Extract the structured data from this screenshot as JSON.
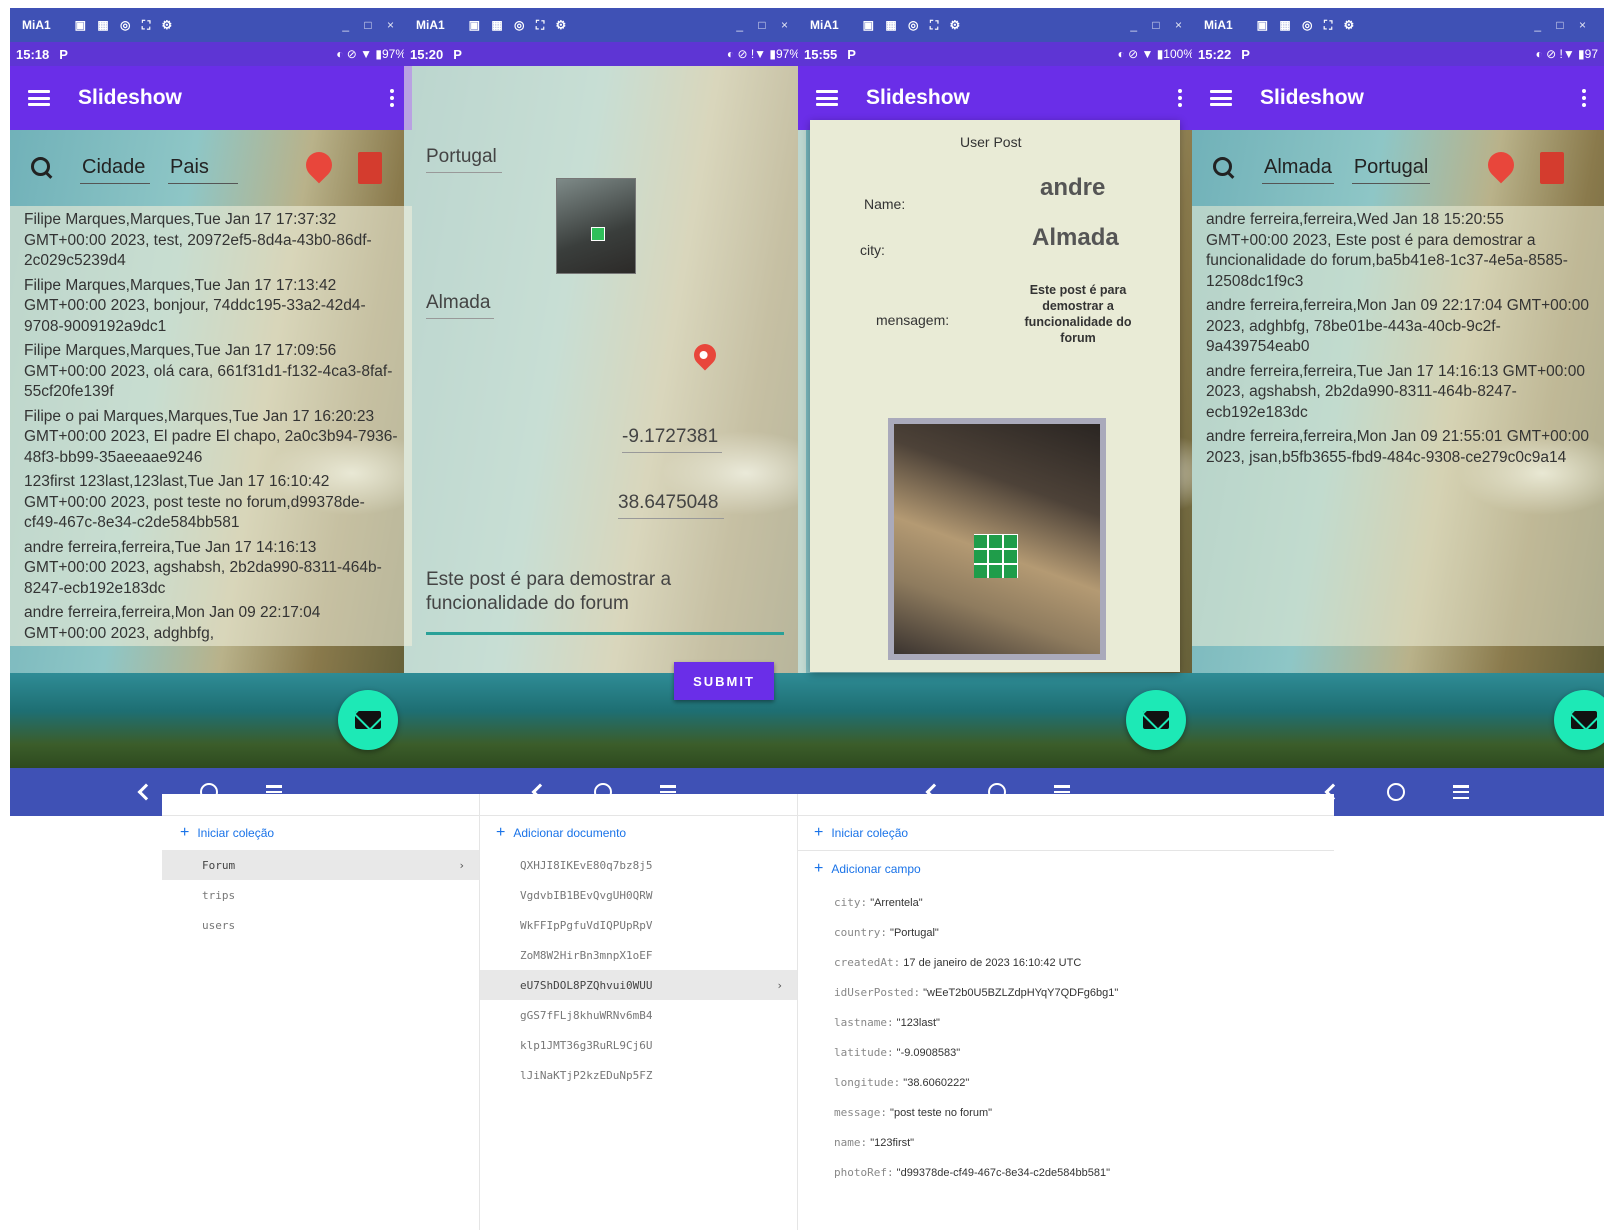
{
  "emulator": {
    "title": "MiA1",
    "toolbar_icons": "▣ ▦ ◎ ⛶ ⚙",
    "window_controls": "_ □ ×"
  },
  "phones": [
    {
      "time": "15:18",
      "status_right": "◐ ⊘ ▼ ▮97%",
      "appbar_title": "Slideshow",
      "search": {
        "city": "Cidade",
        "country": "Pais"
      },
      "posts": [
        "Filipe Marques,Marques,Tue Jan 17 17:37:32 GMT+00:00 2023, test, 20972ef5-8d4a-43b0-86df-2c029c5239d4",
        "Filipe Marques,Marques,Tue Jan 17 17:13:42 GMT+00:00 2023, bonjour, 74ddc195-33a2-42d4-9708-9009192a9dc1",
        "Filipe Marques,Marques,Tue Jan 17 17:09:56 GMT+00:00 2023, olá cara, 661f31d1-f132-4ca3-8faf-55cf20fe139f",
        "Filipe o pai Marques,Marques,Tue Jan 17 16:20:23 GMT+00:00 2023, El padre El chapo, 2a0c3b94-7936-48f3-bb99-35aeeaae9246",
        "123first 123last,123last,Tue Jan 17 16:10:42 GMT+00:00 2023, post teste no forum,d99378de-cf49-467c-8e34-c2de584bb581",
        "andre ferreira,ferreira,Tue Jan 17 14:16:13 GMT+00:00 2023, agshabsh, 2b2da990-8311-464b-8247-ecb192e183dc",
        "andre ferreira,ferreira,Mon Jan 09 22:17:04 GMT+00:00 2023, adghbfg,"
      ]
    },
    {
      "time": "15:20",
      "status_right": "◐ ⊘ !▼ ▮97%",
      "country": "Portugal",
      "city": "Almada",
      "longitude": "-9.1727381",
      "latitude": "38.6475048",
      "message": "Este post é para demostrar a funcionalidade do forum",
      "submit_label": "SUBMIT"
    },
    {
      "time": "15:55",
      "status_right": "◐ ⊘ ▼ ▮100%",
      "appbar_title": "Slideshow",
      "dialog": {
        "title": "User Post",
        "name_label": "Name:",
        "name_value": "andre",
        "city_label": "city:",
        "city_value": "Almada",
        "message_label": "mensagem:",
        "message_value": "Este post é para demostrar a funcionalidade do forum"
      }
    },
    {
      "time": "15:22",
      "status_right": "◐ ⊘ !▼ ▮97",
      "appbar_title": "Slideshow",
      "search": {
        "city": "Almada",
        "country": "Portugal"
      },
      "posts": [
        "andre ferreira,ferreira,Wed Jan 18 15:20:55 GMT+00:00 2023, Este post é para demostrar a funcionalidade do forum,ba5b41e8-1c37-4e5a-8585-12508dc1f9c3",
        "andre ferreira,ferreira,Mon Jan 09 22:17:04 GMT+00:00 2023, adghbfg, 78be01be-443a-40cb-9c2f-9a439754eab0",
        "andre ferreira,ferreira,Tue Jan 17 14:16:13 GMT+00:00 2023, agshabsh, 2b2da990-8311-464b-8247-ecb192e183dc",
        "andre ferreira,ferreira,Mon Jan 09 21:55:01 GMT+00:00 2023, jsan,b5fb3655-fbd9-484c-9308-ce279c0c9a14"
      ]
    }
  ],
  "firestore": {
    "start_collection": "Iniciar coleção",
    "collections": [
      "Forum",
      "trips",
      "users"
    ],
    "add_document": "Adicionar documento",
    "documents": [
      "QXHJI8IKEvE80q7bz8j5",
      "VgdvbIB1BEvQvgUH0QRW",
      "WkFFIpPgfuVdIQPUpRpV",
      "ZoM8W2HirBn3mnpX1oEF",
      "eU7ShDOL8PZQhvui0WUU",
      "gGS7fFLj8khuWRNv6mB4",
      "klp1JMT36g3RuRL9Cj6U",
      "lJiNaKTjP2kzEDuNp5FZ"
    ],
    "start_collection_2": "Iniciar coleção",
    "add_field": "Adicionar campo",
    "fields": [
      {
        "key": "city:",
        "value": "\"Arrentela\""
      },
      {
        "key": "country:",
        "value": "\"Portugal\""
      },
      {
        "key": "createdAt:",
        "value": "17 de janeiro de 2023 16:10:42 UTC"
      },
      {
        "key": "idUserPosted:",
        "value": "\"wEeT2b0U5BZLZdpHYqY7QDFg6bg1\""
      },
      {
        "key": "lastname:",
        "value": "\"123last\""
      },
      {
        "key": "latitude:",
        "value": "\"-9.0908583\""
      },
      {
        "key": "longitude:",
        "value": "\"38.6060222\""
      },
      {
        "key": "message:",
        "value": "\"post teste no forum\""
      },
      {
        "key": "name:",
        "value": "\"123first\""
      },
      {
        "key": "photoRef:",
        "value": "\"d99378de-cf49-467c-8e34-c2de584bb581\""
      }
    ]
  },
  "colors": {
    "appbar": "#6a2ee8",
    "emulator": "#3f51b5",
    "fab": "#1de9b6",
    "link": "#1a73e8"
  }
}
